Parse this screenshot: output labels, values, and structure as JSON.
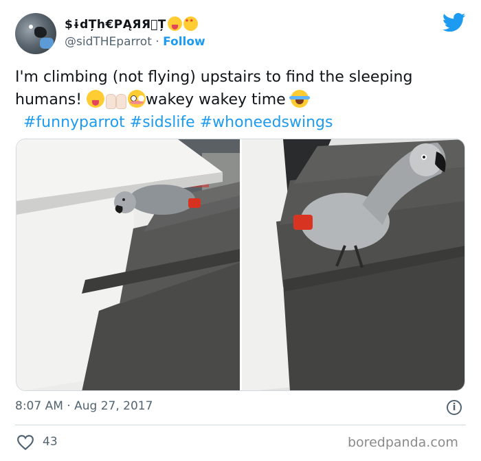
{
  "header": {
    "display_name": "$ɨdȚh€PĄЯЯ⃝Ț",
    "display_name_emojis": [
      "zany-face-emoji",
      "star-struck-emoji"
    ],
    "handle": "@sidTHEparrot",
    "separator": "·",
    "follow_label": "Follow",
    "brand_icon": "twitter-bird-icon"
  },
  "tweet": {
    "text_part1": "I'm climbing (not flying) upstairs to find the sleeping humans! ",
    "emoji_1": "squinting-tongue-emoji",
    "emoji_2": "raising-hands-emoji",
    "emoji_3": "flushed-face-emoji",
    "text_part2": "wakey wakey time ",
    "emoji_4": "tears-of-joy-emoji",
    "hashtags": [
      "#funnyparrot",
      "#sidslife",
      "#whoneedswings"
    ]
  },
  "media": {
    "photos": [
      "parrot-on-stairs-photo-left",
      "parrot-climbing-stairs-photo-right"
    ]
  },
  "footer": {
    "time": "8:07 AM",
    "separator": "·",
    "date": "Aug 27, 2017",
    "info_icon_glyph": "i",
    "like_count": "43",
    "watermark": "boredpanda.com"
  },
  "colors": {
    "accent": "#1d9bf0",
    "text": "#0f1419",
    "secondary": "#536471",
    "divider": "#cfd9de"
  }
}
